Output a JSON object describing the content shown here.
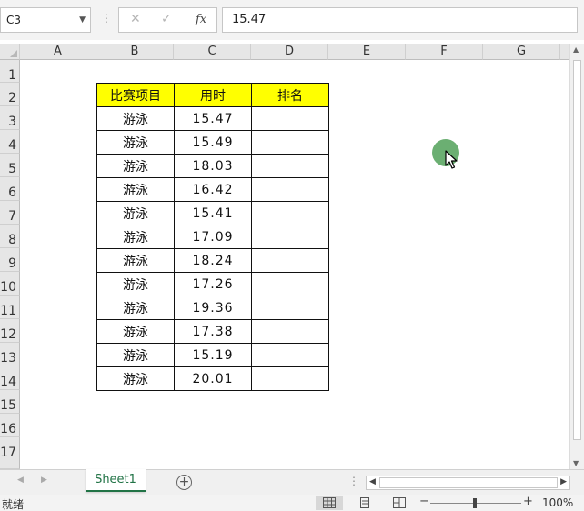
{
  "formula_bar": {
    "name_box": "C3",
    "cancel_icon": "✕",
    "enter_icon": "✓",
    "fx_label": "fx",
    "value": "15.47"
  },
  "columns": [
    "A",
    "B",
    "C",
    "D",
    "E",
    "F",
    "G"
  ],
  "rows": [
    "1",
    "2",
    "3",
    "4",
    "5",
    "6",
    "7",
    "8",
    "9",
    "10",
    "11",
    "12",
    "13",
    "14",
    "15",
    "16",
    "17"
  ],
  "table": {
    "headers": [
      "比赛项目",
      "用时",
      "排名"
    ],
    "header_bg": "#ffff00",
    "rows": [
      {
        "event": "游泳",
        "time": "15.47",
        "rank": ""
      },
      {
        "event": "游泳",
        "time": "15.49",
        "rank": ""
      },
      {
        "event": "游泳",
        "time": "18.03",
        "rank": ""
      },
      {
        "event": "游泳",
        "time": "16.42",
        "rank": ""
      },
      {
        "event": "游泳",
        "time": "15.41",
        "rank": ""
      },
      {
        "event": "游泳",
        "time": "17.09",
        "rank": ""
      },
      {
        "event": "游泳",
        "time": "18.24",
        "rank": ""
      },
      {
        "event": "游泳",
        "time": "17.26",
        "rank": ""
      },
      {
        "event": "游泳",
        "time": "19.36",
        "rank": ""
      },
      {
        "event": "游泳",
        "time": "17.38",
        "rank": ""
      },
      {
        "event": "游泳",
        "time": "15.19",
        "rank": ""
      },
      {
        "event": "游泳",
        "time": "20.01",
        "rank": ""
      }
    ]
  },
  "sheet_tabs": {
    "active": "Sheet1",
    "add_icon": "+"
  },
  "status_bar": {
    "ready": "就绪",
    "zoom": "100%"
  },
  "colors": {
    "accent": "#217346",
    "cursor_highlight": "#63ab6a"
  }
}
